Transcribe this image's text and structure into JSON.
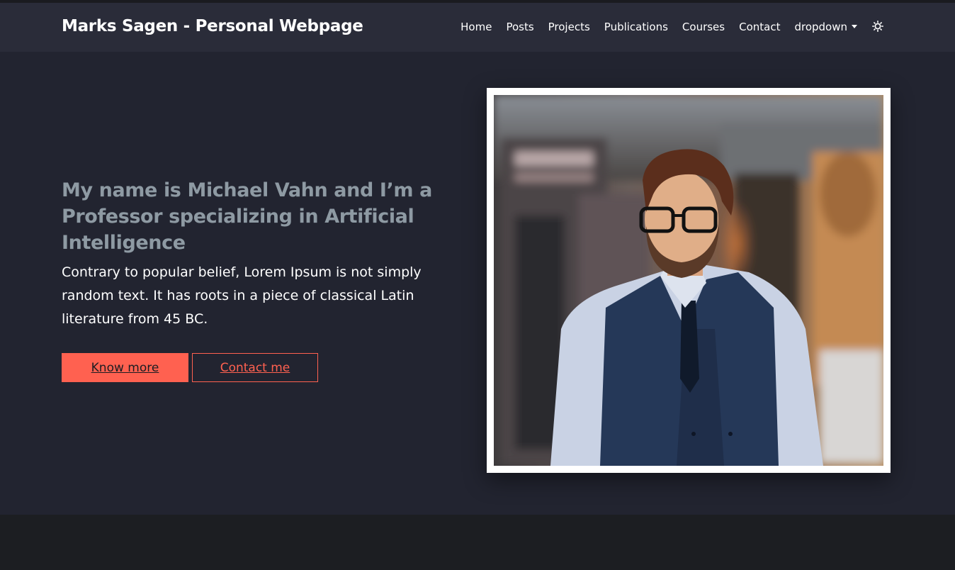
{
  "navbar": {
    "brand": "Marks Sagen - Personal Webpage",
    "links": [
      "Home",
      "Posts",
      "Projects",
      "Publications",
      "Courses",
      "Contact",
      "dropdown"
    ],
    "theme_icon": "sun-icon"
  },
  "hero": {
    "headline": {
      "p1": "My name is ",
      "name": "Michael Vahn",
      "p2": " and I’m a ",
      "role": "Professor",
      "p3": " specializing in ",
      "field": "Artificial Intelligence"
    },
    "lead": "Contrary to popular belief, Lorem Ipsum is not simply random text. It has roots in a piece of classical Latin literature from 45 BC.",
    "primary_button": "Know more",
    "secondary_button": "Contact me",
    "photo_alt": "Portrait photo of a man with glasses wearing a vest and tie"
  },
  "colors": {
    "accent": "#ff6150",
    "navbar_bg": "#2a2c39",
    "hero_bg": "#222430",
    "headline": "#8e9aa3"
  }
}
